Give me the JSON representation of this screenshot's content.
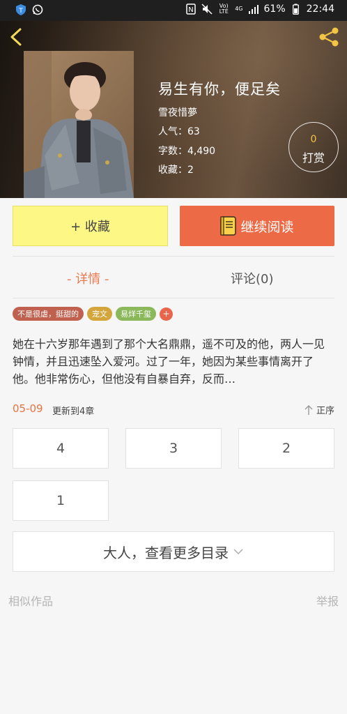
{
  "status_bar": {
    "battery": "61%",
    "time": "22:44",
    "network": "4G",
    "volte": "Vo) LTE"
  },
  "header": {
    "title": "易生有你，便足矣",
    "author": "雪夜惜夢",
    "popularity": "人气：63",
    "word_count": "字数：4,490",
    "favorites": "收藏：2",
    "tip_count": "0",
    "tip_label": "打赏"
  },
  "actions": {
    "collect_label": "+ 收藏",
    "read_label": "继续阅读"
  },
  "tabs": {
    "detail": "- 详情 -",
    "comments": "评论(0)"
  },
  "tags": [
    {
      "label": "不是很虐，挺甜的",
      "color": "#c0614f"
    },
    {
      "label": "宠文",
      "color": "#d4a53a"
    },
    {
      "label": "易烊千玺",
      "color": "#8ab85a"
    },
    {
      "label": "+",
      "color": "#e8654c"
    }
  ],
  "summary": "她在十六岁那年遇到了那个大名鼎鼎，遥不可及的他，两人一见钟情，并且迅速坠入爱河。过了一年，她因为某些事情离开了他。他非常伤心，但他没有自暴自弃，反而…",
  "update": {
    "date": "05-09",
    "text": "更新到4章",
    "sort_label": "正序"
  },
  "chapters": [
    "4",
    "3",
    "2",
    "1"
  ],
  "more_catalog": "大人，查看更多目录",
  "footer": {
    "similar": "相似作品",
    "report": "举报"
  },
  "colors": {
    "accent": "#ec6a45",
    "collect_bg": "#fdf785",
    "date_orange": "#e8733f"
  }
}
